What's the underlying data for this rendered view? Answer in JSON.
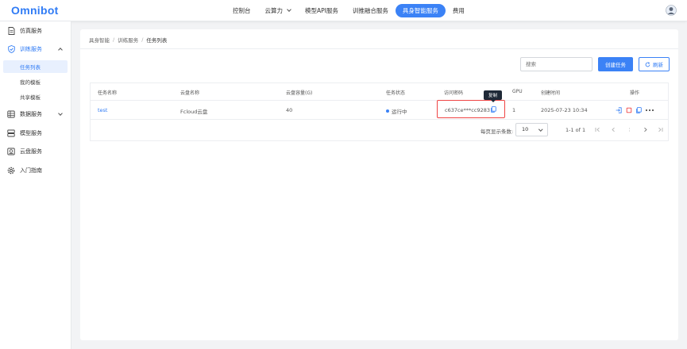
{
  "app": {
    "logo": "Omnibot"
  },
  "topnav": {
    "items": [
      {
        "label": "控制台"
      },
      {
        "label": "云算力"
      },
      {
        "label": "模型API服务"
      },
      {
        "label": "训推融合服务"
      },
      {
        "label": "具身智能服务"
      },
      {
        "label": "费用"
      }
    ]
  },
  "sidebar": {
    "items": [
      {
        "label": "仿真服务",
        "icon": "document-icon"
      },
      {
        "label": "训练服务",
        "icon": "shield-icon"
      },
      {
        "label": "数据服务",
        "icon": "database-icon"
      },
      {
        "label": "模型服务",
        "icon": "server-icon"
      },
      {
        "label": "云盘服务",
        "icon": "cloud-disk-icon"
      },
      {
        "label": "入门指南",
        "icon": "gear-icon"
      }
    ],
    "sub_items": [
      {
        "label": "任务列表"
      },
      {
        "label": "我的模板"
      },
      {
        "label": "共享模板"
      }
    ]
  },
  "breadcrumb": {
    "root": "具身智能",
    "middle": "训练服务",
    "current": "任务列表"
  },
  "toolbar": {
    "search_placeholder": "搜索",
    "create_label": "创建任务",
    "refresh_label": "刷新"
  },
  "table": {
    "columns": [
      "任务名称",
      "云盘名称",
      "云盘容量(G)",
      "任务状态",
      "访问密码",
      "GPU",
      "创建时间",
      "操作"
    ],
    "rows": [
      {
        "name": "test",
        "disk_name": "Fcloud云盘",
        "capacity": "40",
        "status": "运行中",
        "password": "c637ce***cc9283",
        "gpu": "1",
        "created": "2025-07-23 10:34"
      }
    ],
    "copy_tooltip": "复制"
  },
  "pagination": {
    "per_page_label": "每页显示条数:",
    "per_page_value": "10",
    "range": "1-1 of 1"
  },
  "colors": {
    "primary": "#3b82f6",
    "highlight_border": "#ef4444"
  }
}
